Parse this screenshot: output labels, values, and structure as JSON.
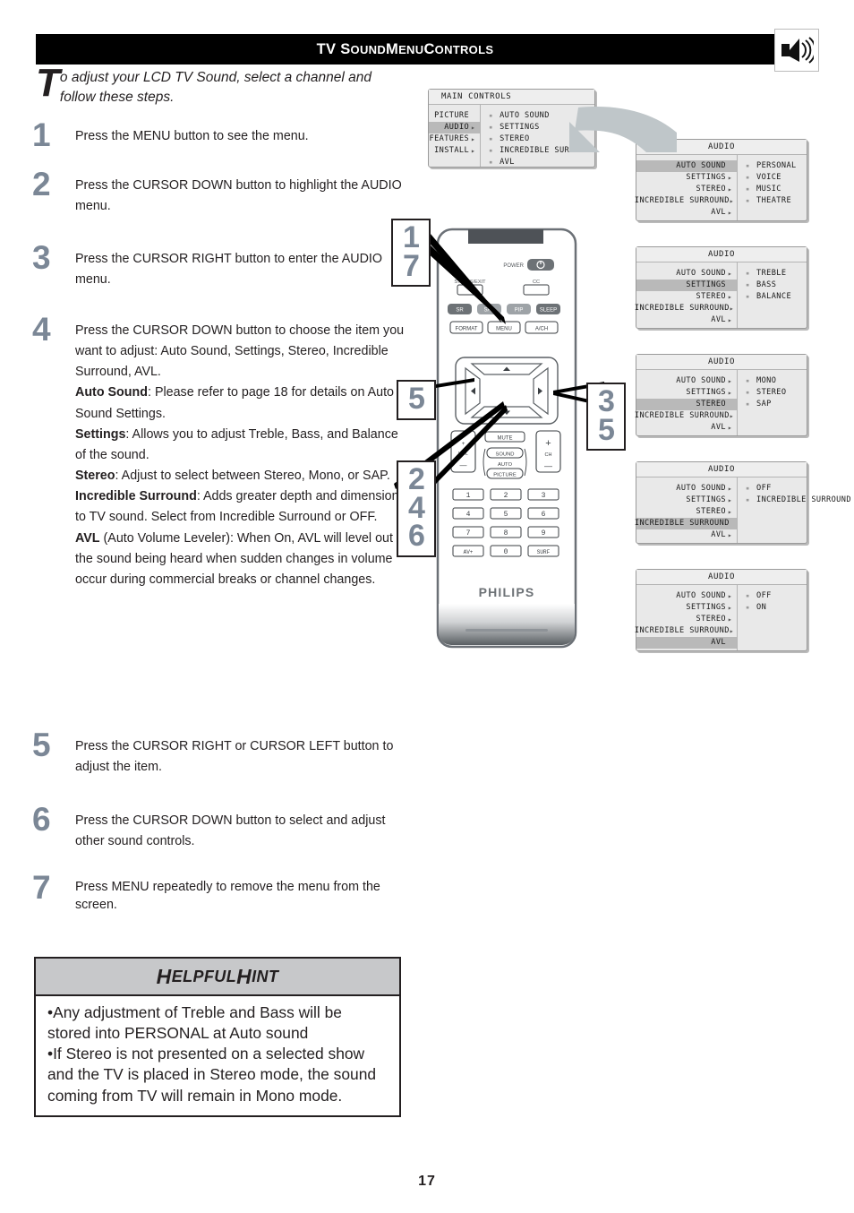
{
  "header": {
    "title_parts": [
      {
        "t": "TV S",
        "big": true
      },
      {
        "t": "OUND",
        "big": false
      },
      {
        "t": " M",
        "big": true
      },
      {
        "t": "ENU",
        "big": false
      },
      {
        "t": " C",
        "big": true
      },
      {
        "t": "ONTROLS",
        "big": false
      }
    ],
    "title_plain": "TV Sound Menu Controls",
    "icon": "speaker-sound-icon"
  },
  "intro": {
    "dropcap": "T",
    "text": "o adjust your LCD TV Sound, select a channel and follow these steps."
  },
  "steps": [
    {
      "num": "1",
      "html": "Press the MENU button to see the menu."
    },
    {
      "num": "2",
      "html": "Press the CURSOR DOWN button to highlight the AUDIO menu."
    },
    {
      "num": "3",
      "html": "Press the CURSOR RIGHT button to enter the AUDIO menu."
    },
    {
      "num": "4",
      "html": "Press the CURSOR DOWN button to choose the item you want to adjust: Auto Sound, Settings, Stereo, Incredible Surround, AVL.<br><b>Auto Sound</b>: Please refer to page 18 for details on Auto Sound Settings.<br><b>Settings</b>: Allows you to adjust Treble, Bass, and Balance of the sound.<br><b>Stereo</b>: Adjust to select between Stereo, Mono, or SAP.<br><b>Incredible Surround</b>: Adds greater depth and dimension to TV sound. Select from Incredible Surround or OFF.<br><b>AVL</b> (Auto Volume Leveler): When On, AVL will level out the sound being heard when sudden changes in volume occur during commercial breaks or channel changes."
    },
    {
      "num": "5",
      "html": "Press the CURSOR RIGHT or CURSOR LEFT button to adjust the item."
    },
    {
      "num": "6",
      "html": "Press the CURSOR DOWN button to select and adjust other sound controls."
    },
    {
      "num": "7",
      "html": "Press MENU repeatedly to remove the menu from the screen."
    }
  ],
  "callouts": [
    {
      "id": "callout-1-7",
      "lines": [
        "1",
        "7"
      ]
    },
    {
      "id": "callout-5",
      "lines": [
        "5"
      ]
    },
    {
      "id": "callout-2-4-6",
      "lines": [
        "2",
        "4",
        "6"
      ]
    },
    {
      "id": "callout-3-5",
      "lines": [
        "3",
        "5"
      ]
    }
  ],
  "menus": {
    "main": {
      "title": "MAIN CONTROLS",
      "left": [
        {
          "label": "PICTURE",
          "arrow": false,
          "selected": false
        },
        {
          "label": "AUDIO",
          "arrow": true,
          "selected": true
        },
        {
          "label": "FEATURES",
          "arrow": true,
          "selected": false
        },
        {
          "label": "INSTALL",
          "arrow": true,
          "selected": false
        }
      ],
      "right": [
        "AUTO SOUND",
        "SETTINGS",
        "STEREO",
        "INCREDIBLE SURROUND",
        "AVL"
      ]
    },
    "audio_menus": [
      {
        "title": "AUDIO",
        "left": [
          {
            "label": "AUTO SOUND",
            "arrow": false,
            "selected": true
          },
          {
            "label": "SETTINGS",
            "arrow": true,
            "selected": false
          },
          {
            "label": "STEREO",
            "arrow": true,
            "selected": false
          },
          {
            "label": "INCREDIBLE SURROUND",
            "arrow": true,
            "selected": false
          },
          {
            "label": "AVL",
            "arrow": true,
            "selected": false
          }
        ],
        "right": [
          "PERSONAL",
          "VOICE",
          "MUSIC",
          "THEATRE"
        ]
      },
      {
        "title": "AUDIO",
        "left": [
          {
            "label": "AUTO SOUND",
            "arrow": true,
            "selected": false
          },
          {
            "label": "SETTINGS",
            "arrow": false,
            "selected": true
          },
          {
            "label": "STEREO",
            "arrow": true,
            "selected": false
          },
          {
            "label": "INCREDIBLE SURROUND",
            "arrow": true,
            "selected": false
          },
          {
            "label": "AVL",
            "arrow": true,
            "selected": false
          }
        ],
        "right": [
          "TREBLE",
          "BASS",
          "BALANCE"
        ]
      },
      {
        "title": "AUDIO",
        "left": [
          {
            "label": "AUTO SOUND",
            "arrow": true,
            "selected": false
          },
          {
            "label": "SETTINGS",
            "arrow": true,
            "selected": false
          },
          {
            "label": "STEREO",
            "arrow": false,
            "selected": true
          },
          {
            "label": "INCREDIBLE SURROUND",
            "arrow": true,
            "selected": false
          },
          {
            "label": "AVL",
            "arrow": true,
            "selected": false
          }
        ],
        "right": [
          "MONO",
          "STEREO",
          "SAP"
        ]
      },
      {
        "title": "AUDIO",
        "left": [
          {
            "label": "AUTO SOUND",
            "arrow": true,
            "selected": false
          },
          {
            "label": "SETTINGS",
            "arrow": true,
            "selected": false
          },
          {
            "label": "STEREO",
            "arrow": true,
            "selected": false
          },
          {
            "label": "INCREDIBLE SURROUND",
            "arrow": false,
            "selected": true
          },
          {
            "label": "AVL",
            "arrow": true,
            "selected": false
          }
        ],
        "right": [
          "OFF",
          "INCREDIBLE SURROUND"
        ]
      },
      {
        "title": "AUDIO",
        "left": [
          {
            "label": "AUTO SOUND",
            "arrow": true,
            "selected": false
          },
          {
            "label": "SETTINGS",
            "arrow": true,
            "selected": false
          },
          {
            "label": "STEREO",
            "arrow": true,
            "selected": false
          },
          {
            "label": "INCREDIBLE SURROUND",
            "arrow": true,
            "selected": false
          },
          {
            "label": "AVL",
            "arrow": false,
            "selected": true
          }
        ],
        "right": [
          "OFF",
          "ON"
        ]
      }
    ]
  },
  "remote": {
    "brand": "PHILIPS",
    "power_label": "POWER",
    "status_label": "STATUS/EXIT",
    "cc_label": "CC",
    "row_dark": [
      "SR",
      "SAP",
      "PIP",
      "SLEEP"
    ],
    "row_light": [
      "FORMAT",
      "MENU",
      "A/CH"
    ],
    "vol_label": "VOL",
    "ch_label": "CH",
    "mute_label": "MUTE",
    "sound_label": "SOUND",
    "auto_label": "AUTO",
    "picture_label": "PICTURE",
    "keypad": [
      "1",
      "2",
      "3",
      "4",
      "5",
      "6",
      "7",
      "8",
      "9",
      "AV+",
      "0",
      "SURF"
    ],
    "plus": "+",
    "minus": "–"
  },
  "hint": {
    "title_parts": [
      {
        "t": "H",
        "big": true
      },
      {
        "t": "ELPFUL",
        "big": false
      },
      {
        "t": " H",
        "big": true
      },
      {
        "t": "INT",
        "big": false
      }
    ],
    "title_plain": "Helpful Hint",
    "bullets": [
      "•Any adjustment of Treble and Bass will be stored into PERSONAL at Auto sound",
      "•If Stereo is not presented on a selected show and the TV is placed in Stereo mode, the sound coming from TV will remain in Mono mode."
    ]
  },
  "page_number": "17",
  "colors": {
    "header_bg": "#000000",
    "step_number": "#7b8796",
    "hint_head_bg": "#c7c8ca",
    "osd_bg": "#e9e9e9",
    "osd_selected": "#b9b9b9"
  }
}
